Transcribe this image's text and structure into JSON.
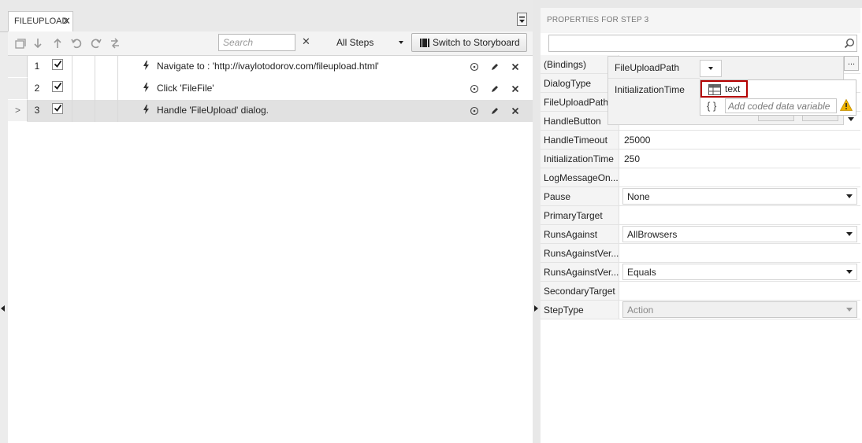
{
  "document_tab": {
    "title": "FILEUPLOAD",
    "close_glyph": "✕"
  },
  "toolbar": {
    "icons": [
      "steps-view-icon",
      "move-down-icon",
      "move-up-icon",
      "undo-icon",
      "redo-icon",
      "refresh-icon"
    ],
    "search": {
      "placeholder": "Search",
      "value": ""
    },
    "search_clear_glyph": "✕",
    "filter": {
      "selected": "All Steps"
    },
    "storyboard_button": "Switch to Storyboard"
  },
  "steps": [
    {
      "number": "1",
      "checked": true,
      "description": "Navigate to : 'http://ivaylotodorov.com/fileupload.html'",
      "selected": false
    },
    {
      "number": "2",
      "checked": true,
      "description": "Click 'FileFile'",
      "selected": false
    },
    {
      "number": "3",
      "checked": true,
      "description": "Handle 'FileUpload' dialog.",
      "selected": true
    }
  ],
  "selected_row_marker": ">",
  "properties": {
    "title": "PROPERTIES FOR STEP 3",
    "search": {
      "placeholder": "",
      "value": ""
    },
    "rows": [
      {
        "name": "(Bindings)",
        "value": ""
      },
      {
        "name": "DialogType",
        "value": ""
      },
      {
        "name": "FileUploadPath",
        "value": ""
      },
      {
        "name": "HandleButton",
        "value": ""
      },
      {
        "name": "HandleTimeout",
        "value": "25000"
      },
      {
        "name": "InitializationTime",
        "value": "250"
      },
      {
        "name": "LogMessageOn...",
        "value": ""
      },
      {
        "name": "Pause",
        "value": "None",
        "combo": true
      },
      {
        "name": "PrimaryTarget",
        "value": ""
      },
      {
        "name": "RunsAgainst",
        "value": "AllBrowsers",
        "combo": true
      },
      {
        "name": "RunsAgainstVer...",
        "value": ""
      },
      {
        "name": "RunsAgainstVer...",
        "value": "Equals",
        "combo": true
      },
      {
        "name": "SecondaryTarget",
        "value": ""
      },
      {
        "name": "StepType",
        "value": "Action",
        "combo": true,
        "disabled": true
      }
    ]
  },
  "bindings_popup": {
    "keys": [
      "FileUploadPath",
      "InitializationTime"
    ],
    "more_button": "...",
    "option_text": "text",
    "coded_variable_glyph": "{ }",
    "coded_variable_placeholder": "Add coded data variable"
  },
  "colors": {
    "selected_row": "#e1e1e1",
    "highlight_border": "#b40000",
    "warning": "#f0b400"
  }
}
